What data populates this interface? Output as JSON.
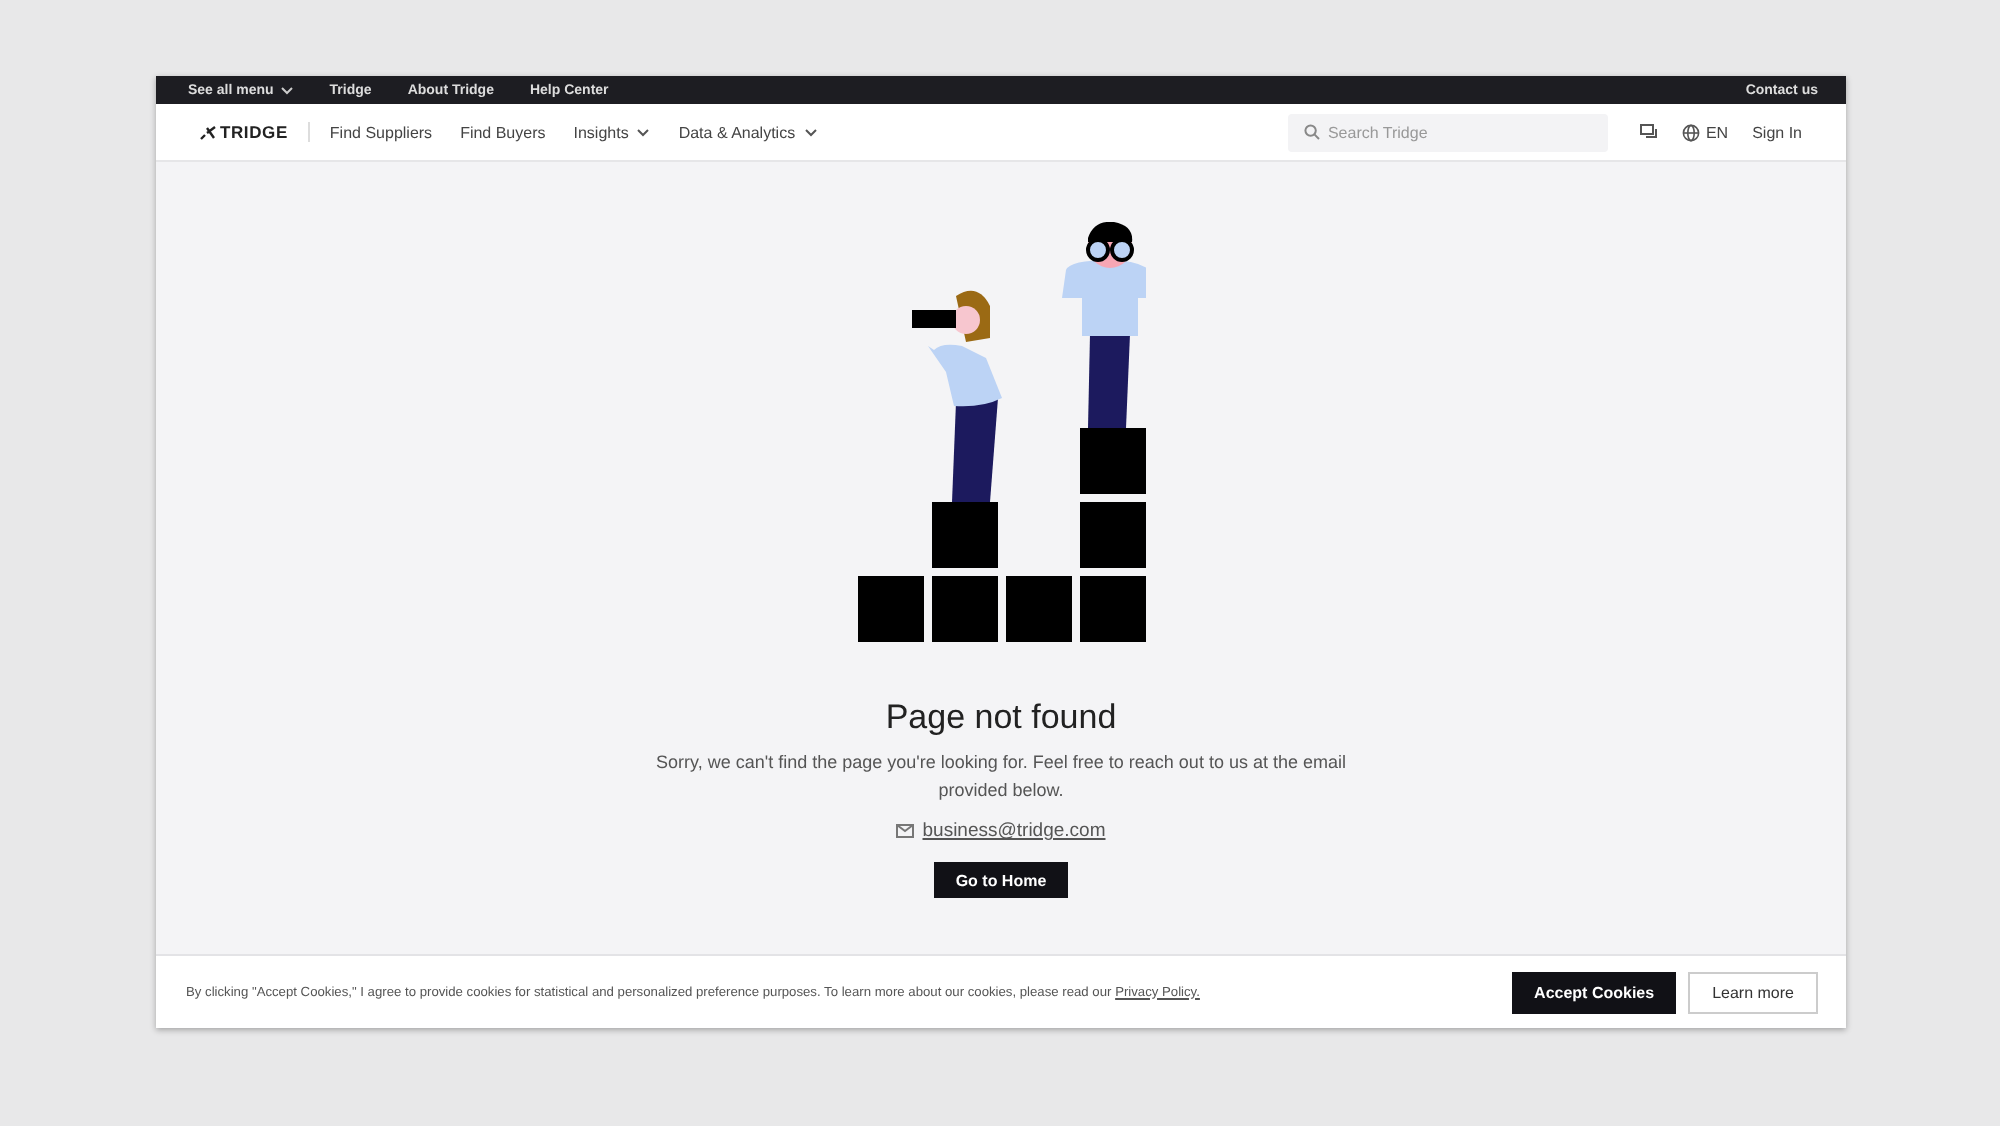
{
  "top_bar": {
    "links": [
      {
        "label": "See all menu",
        "dropdown": true
      },
      {
        "label": "Tridge",
        "dropdown": false
      },
      {
        "label": "About Tridge",
        "dropdown": false
      },
      {
        "label": "Help Center",
        "dropdown": false
      }
    ],
    "contact": "Contact us"
  },
  "nav": {
    "logo": "TRIDGE",
    "items": [
      {
        "label": "Find Suppliers",
        "dropdown": false
      },
      {
        "label": "Find Buyers",
        "dropdown": false
      },
      {
        "label": "Insights",
        "dropdown": true
      },
      {
        "label": "Data & Analytics",
        "dropdown": true
      }
    ],
    "search": {
      "placeholder": "Search Tridge"
    },
    "language": "EN",
    "sign_in": "Sign In"
  },
  "error": {
    "title": "Page not found",
    "message": "Sorry, we can't find the page you're looking for. Feel free to reach out to us at the email provided below.",
    "email": "business@tridge.com",
    "button": "Go to Home"
  },
  "cookie_bar": {
    "text": "By clicking \"Accept Cookies,\" I agree to provide cookies for statistical and personalized preference purposes. To learn more about our cookies, please read our",
    "link": "Privacy Policy.",
    "accept": "Accept Cookies",
    "learn_more": "Learn more"
  }
}
